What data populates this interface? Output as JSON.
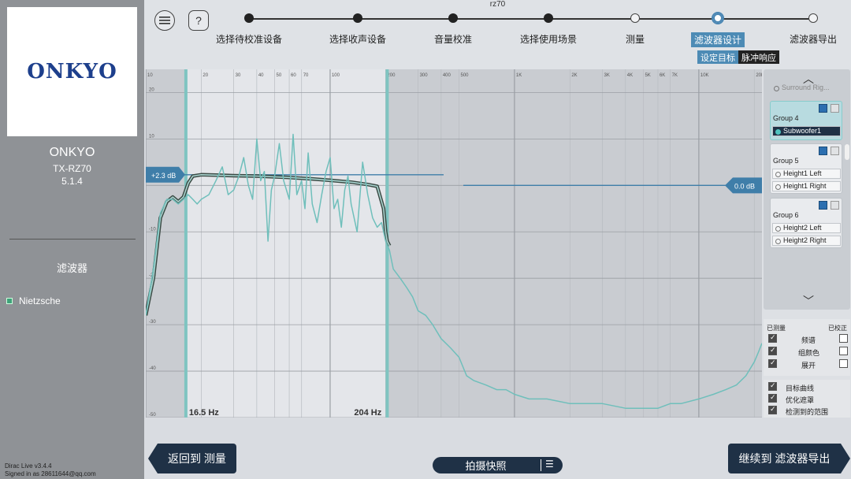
{
  "sidebar": {
    "logo_text": "ONKYO",
    "device_name": "ONKYO",
    "device_model": "TX-RZ70",
    "device_config": "5.1.4",
    "section_title": "滤波器",
    "filter_item": "Nietzsche",
    "version": "Dirac Live v3.4.4",
    "signed_in": "Signed in as 28611644@qq.com"
  },
  "header": {
    "session_name": "rz70",
    "menu_icon": "hamburger-icon",
    "help_label": "?",
    "steps": [
      {
        "label": "选择待校准设备",
        "state": "done"
      },
      {
        "label": "选择收声设备",
        "state": "done"
      },
      {
        "label": "音量校准",
        "state": "done"
      },
      {
        "label": "选择使用场景",
        "state": "done"
      },
      {
        "label": "测量",
        "state": "open"
      },
      {
        "label": "滤波器设计",
        "state": "current"
      },
      {
        "label": "滤波器导出",
        "state": "open"
      }
    ],
    "subtabs": {
      "target": "设定目标",
      "impulse": "脉冲响应"
    }
  },
  "chart_data": {
    "type": "line",
    "x_scale": "log",
    "xlim": [
      10,
      22000
    ],
    "ylim": [
      -50,
      25
    ],
    "x_ticks": [
      "10",
      "20",
      "30",
      "40",
      "50",
      "60",
      "70",
      "100",
      "200",
      "300",
      "400",
      "500",
      "1K",
      "2K",
      "3K",
      "4K",
      "5K",
      "6K",
      "7K",
      "10K",
      "20K"
    ],
    "x_tick_values": [
      10,
      20,
      30,
      40,
      50,
      60,
      70,
      100,
      200,
      300,
      400,
      500,
      1000,
      2000,
      3000,
      4000,
      5000,
      6000,
      7000,
      10000,
      20000
    ],
    "y_ticks": [
      "20",
      "10",
      "-10",
      "-20",
      "-30",
      "-40",
      "-50"
    ],
    "y_tick_values": [
      20,
      10,
      -10,
      -20,
      -30,
      -40,
      -50
    ],
    "low_cutoff_label": "16.5 Hz",
    "high_cutoff_label": "204 Hz",
    "low_cutoff_hz": 16.5,
    "high_cutoff_hz": 204,
    "left_gain_label": "+2.3 dB",
    "right_gain_label": "0.0 dB",
    "left_gain_db": 2.3,
    "right_gain_db": 0.0,
    "series": [
      {
        "role": "target",
        "color": "#3a4a44",
        "x": [
          10,
          11,
          12,
          13,
          14,
          15,
          16,
          17,
          18,
          20,
          25,
          30,
          40,
          60,
          80,
          100,
          130,
          160,
          180,
          195,
          200,
          204,
          210
        ],
        "y": [
          -28,
          -20,
          -7,
          -3.5,
          -2.5,
          -3.5,
          -2.5,
          0.5,
          2.0,
          2.3,
          2.2,
          2.1,
          2.0,
          1.7,
          1.4,
          1.1,
          0.7,
          0.2,
          -0.2,
          -5,
          -10,
          -12,
          -13
        ]
      },
      {
        "role": "measured",
        "color": "#6fbfbb",
        "x": [
          10,
          11,
          12,
          13,
          14,
          15,
          16,
          17,
          18,
          19,
          20,
          22,
          24,
          26,
          28,
          30,
          32,
          34,
          36,
          38,
          40,
          42,
          44,
          46,
          48,
          50,
          53,
          56,
          60,
          63,
          66,
          70,
          73,
          76,
          80,
          85,
          90,
          95,
          100,
          105,
          110,
          115,
          120,
          125,
          130,
          140,
          150,
          160,
          170,
          180,
          190,
          200,
          210,
          220,
          240,
          260,
          280,
          300,
          330,
          360,
          400,
          450,
          500,
          550,
          600,
          700,
          800,
          900,
          1000,
          1200,
          1500,
          2000,
          2500,
          3000,
          4000,
          5000,
          6000,
          7000,
          8000,
          10000,
          12000,
          14000,
          16000,
          18000,
          20000,
          21000,
          22000
        ],
        "y": [
          -28,
          -18,
          -6,
          -3,
          -3,
          -4,
          -3,
          -2,
          -3,
          -4,
          -3,
          -2,
          1,
          4,
          -2,
          -1,
          2,
          6,
          0,
          -3,
          10,
          1,
          3,
          -12,
          -1,
          2,
          9,
          1,
          -3,
          11,
          -2,
          1,
          -5,
          7,
          -4,
          -8,
          -2,
          3,
          6,
          -5,
          -3,
          -9,
          -1,
          2,
          -4,
          -10,
          5,
          -2,
          -7,
          -9,
          -8,
          -12,
          -14,
          -18,
          -20,
          -22,
          -24,
          -27,
          -28,
          -30,
          -33,
          -35,
          -37,
          -41,
          -42,
          -43,
          -44,
          -44,
          -45,
          -46,
          -46,
          -47,
          -47,
          -47,
          -48,
          -48,
          -48,
          -47,
          -47,
          -46,
          -45,
          -44,
          -43,
          -41,
          -38,
          -36,
          -34
        ]
      }
    ]
  },
  "groups": {
    "top_partial": "Surround Rig...",
    "items": [
      {
        "title": "Group 4",
        "channels": [
          "Subwoofer1"
        ],
        "active_channel": "Subwoofer1"
      },
      {
        "title": "Group 5",
        "channels": [
          "Height1 Left",
          "Height1 Right"
        ]
      },
      {
        "title": "Group 6",
        "channels": [
          "Height2 Left",
          "Height2 Right"
        ]
      }
    ]
  },
  "legend": {
    "col_measured": "已测量",
    "col_corrected": "已校正",
    "rows": [
      {
        "label": "频谱",
        "measured": true,
        "corrected": false
      },
      {
        "label": "组颜色",
        "measured": true,
        "corrected": false
      },
      {
        "label": "展开",
        "measured": true,
        "corrected": false
      }
    ],
    "rows2": [
      {
        "label": "目标曲线",
        "checked": true
      },
      {
        "label": "优化遮罩",
        "checked": true
      },
      {
        "label": "检测到的范围",
        "checked": true
      }
    ]
  },
  "footer": {
    "back_label": "返回到 测量",
    "snapshot_label": "拍摄快照",
    "snapshot_menu_icon": "list-menu-icon",
    "next_label": "继续到 滤波器导出"
  }
}
